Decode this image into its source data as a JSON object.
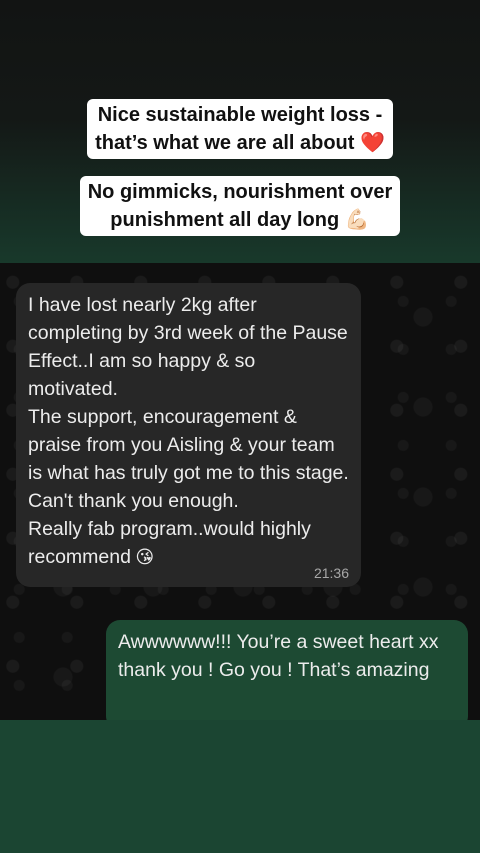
{
  "captions": {
    "line1": "Nice sustainable weight loss -",
    "line2": "that’s what we are all about ❤️",
    "line3": "No gimmicks, nourishment over",
    "line4": "punishment all day long 💪🏻"
  },
  "chat": {
    "incoming": {
      "text": "I have lost nearly 2kg after completing by 3rd week of the Pause Effect..I am so happy & so motivated.\nThe support, encouragement & praise from you Aisling & your team is what has truly got me to this stage.\nCan't thank you enough.\nReally fab program..would highly recommend",
      "emoji": "😘",
      "time": "21:36"
    },
    "outgoing": {
      "text": "Awwwwww!!! You’re a sweet heart xx thank you ! Go you ! That’s amazing"
    }
  },
  "colors": {
    "top_background": "#141816",
    "incoming_bubble": "#272727",
    "outgoing_bubble": "#1d4a33",
    "page_green": "#1b4532"
  }
}
